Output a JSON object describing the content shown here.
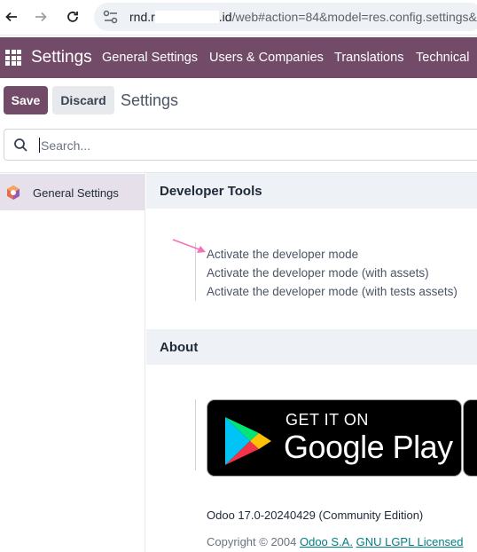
{
  "browser": {
    "url_host_start": "rnd.r",
    "url_host_end": ".id",
    "url_path": "/web#action=84&model=res.config.settings&"
  },
  "navbar": {
    "brand": "Settings",
    "menu": [
      "General Settings",
      "Users & Companies",
      "Translations",
      "Technical"
    ]
  },
  "control_panel": {
    "save_label": "Save",
    "discard_label": "Discard",
    "title": "Settings"
  },
  "search": {
    "placeholder": "Search..."
  },
  "sidebar": {
    "items": [
      {
        "label": "General Settings",
        "icon": "odoo-logo-icon",
        "active": true
      }
    ]
  },
  "developer_tools": {
    "title": "Developer Tools",
    "links": [
      "Activate the developer mode",
      "Activate the developer mode (with assets)",
      "Activate the developer mode (with tests assets)"
    ]
  },
  "about": {
    "title": "About",
    "store_badge": {
      "small_text": "GET IT ON",
      "big_text": "Google Play"
    },
    "version": "Odoo 17.0-20240429 (Community Edition)",
    "copyright_prefix": "Copyright © 2004",
    "company_link": "Odoo S.A.",
    "license_link": "GNU LGPL Licensed"
  },
  "colors": {
    "brand": "#714b67",
    "link": "#017e84",
    "section_bg": "#eef1f5",
    "annotation_arrow": "#f472b6"
  }
}
